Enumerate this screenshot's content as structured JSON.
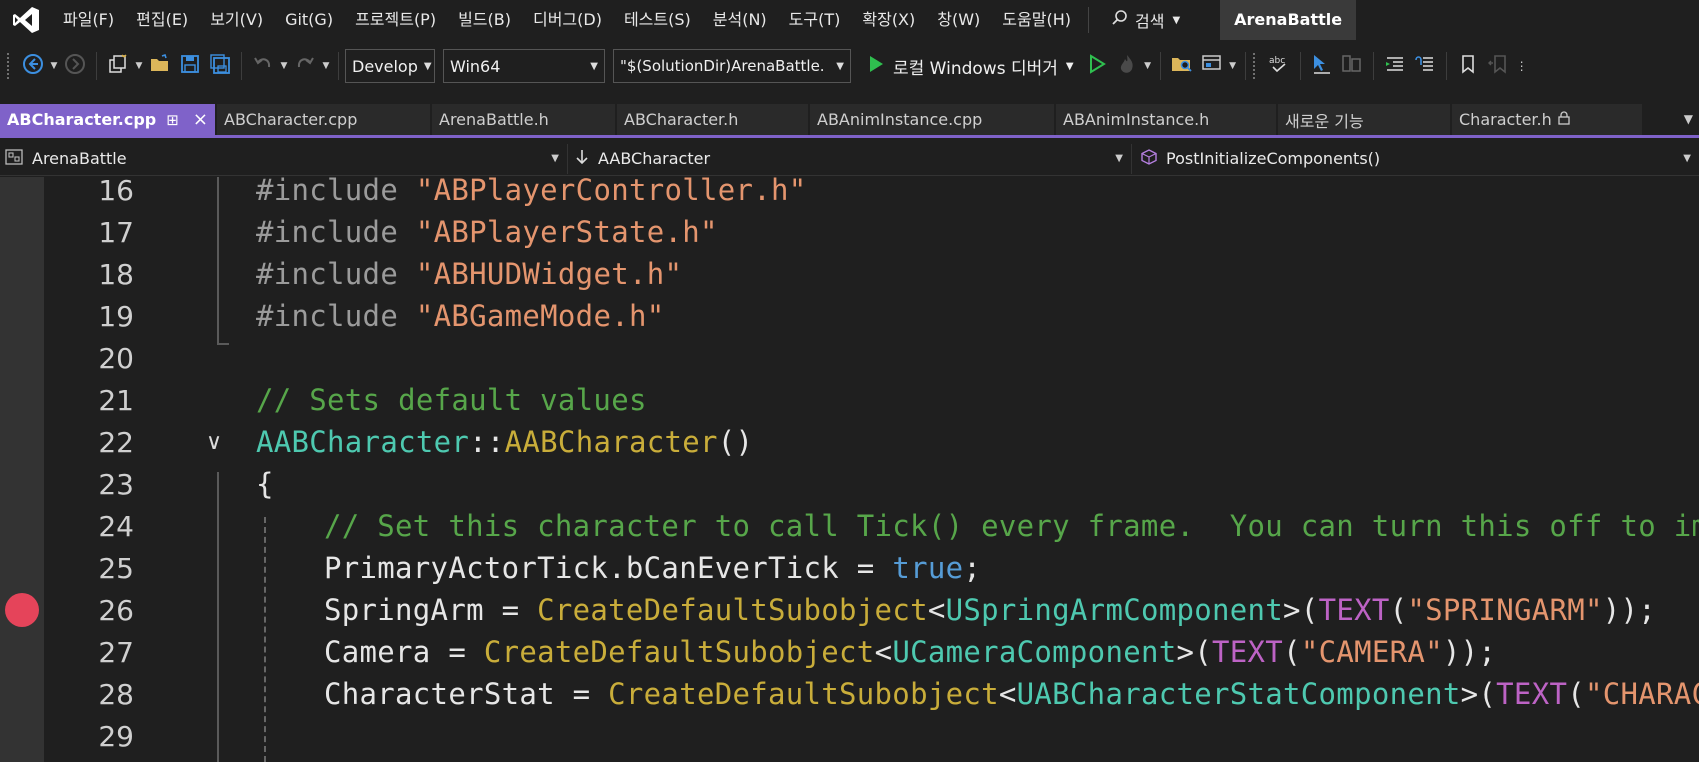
{
  "menu": {
    "items": [
      "파일(F)",
      "편집(E)",
      "보기(V)",
      "Git(G)",
      "프로젝트(P)",
      "빌드(B)",
      "디버그(D)",
      "테스트(S)",
      "분석(N)",
      "도구(T)",
      "확장(X)",
      "창(W)",
      "도움말(H)"
    ],
    "search_label": "검색",
    "solution_title": "ArenaBattle"
  },
  "toolbar": {
    "configuration": "Develop",
    "platform": "Win64",
    "startup_path": "\"$(SolutionDir)ArenaBattle.",
    "run_label": "로컬 Windows 디버거",
    "colors": {
      "run_green": "#2fbf4f",
      "accent_blue": "#3c8fe0"
    }
  },
  "tabs": [
    {
      "label": "ABCharacter.cpp",
      "active": true
    },
    {
      "label": "ABCharacter.cpp",
      "active": false
    },
    {
      "label": "ArenaBattle.h",
      "active": false
    },
    {
      "label": "ABCharacter.h",
      "active": false
    },
    {
      "label": "ABAnimInstance.cpp",
      "active": false
    },
    {
      "label": "ABAnimInstance.h",
      "active": false
    },
    {
      "label": "새로운 기능",
      "active": false
    },
    {
      "label": "Character.h",
      "active": false,
      "locked": true
    }
  ],
  "navbar": {
    "project": "ArenaBattle",
    "scope": "AABCharacter",
    "member": "PostInitializeComponents()"
  },
  "editor": {
    "breakpoint_line": 26,
    "lines": [
      {
        "n": "16",
        "tokens": [
          [
            "pp",
            "#include "
          ],
          [
            "str",
            "\"ABPlayerController.h\""
          ]
        ]
      },
      {
        "n": "17",
        "tokens": [
          [
            "pp",
            "#include "
          ],
          [
            "str",
            "\"ABPlayerState.h\""
          ]
        ]
      },
      {
        "n": "18",
        "tokens": [
          [
            "pp",
            "#include "
          ],
          [
            "str",
            "\"ABHUDWidget.h\""
          ]
        ]
      },
      {
        "n": "19",
        "tokens": [
          [
            "pp",
            "#include "
          ],
          [
            "str",
            "\"ABGameMode.h\""
          ]
        ]
      },
      {
        "n": "20",
        "tokens": []
      },
      {
        "n": "21",
        "tokens": [
          [
            "cm",
            "// Sets default values"
          ]
        ]
      },
      {
        "n": "22",
        "fold": true,
        "tokens": [
          [
            "ty",
            "AABCharacter"
          ],
          [
            "tx",
            "::"
          ],
          [
            "fn",
            "AABCharacter"
          ],
          [
            "tx",
            "()"
          ]
        ]
      },
      {
        "n": "23",
        "tokens": [
          [
            "tx",
            "{"
          ]
        ]
      },
      {
        "n": "24",
        "indent": 1,
        "tokens": [
          [
            "cm",
            "// Set this character to call Tick() every frame.  You can turn this off to impr"
          ]
        ]
      },
      {
        "n": "25",
        "indent": 1,
        "tokens": [
          [
            "tx",
            "PrimaryActorTick.bCanEverTick = "
          ],
          [
            "kw",
            "true"
          ],
          [
            "tx",
            ";"
          ]
        ]
      },
      {
        "n": "26",
        "indent": 1,
        "tokens": [
          [
            "tx",
            "SpringArm = "
          ],
          [
            "fn",
            "CreateDefaultSubobject"
          ],
          [
            "tx",
            "<"
          ],
          [
            "ty",
            "USpringArmComponent"
          ],
          [
            "tx",
            ">("
          ],
          [
            "mac",
            "TEXT"
          ],
          [
            "tx",
            "("
          ],
          [
            "str",
            "\"SPRINGARM\""
          ],
          [
            "tx",
            "));"
          ]
        ]
      },
      {
        "n": "27",
        "indent": 1,
        "tokens": [
          [
            "tx",
            "Camera = "
          ],
          [
            "fn",
            "CreateDefaultSubobject"
          ],
          [
            "tx",
            "<"
          ],
          [
            "ty",
            "UCameraComponent"
          ],
          [
            "tx",
            ">("
          ],
          [
            "mac",
            "TEXT"
          ],
          [
            "tx",
            "("
          ],
          [
            "str",
            "\"CAMERA\""
          ],
          [
            "tx",
            "));"
          ]
        ]
      },
      {
        "n": "28",
        "indent": 1,
        "tokens": [
          [
            "tx",
            "CharacterStat = "
          ],
          [
            "fn",
            "CreateDefaultSubobject"
          ],
          [
            "tx",
            "<"
          ],
          [
            "ty",
            "UABCharacterStatComponent"
          ],
          [
            "tx",
            ">("
          ],
          [
            "mac",
            "TEXT"
          ],
          [
            "tx",
            "("
          ],
          [
            "str",
            "\"CHARACTE"
          ]
        ]
      },
      {
        "n": "29",
        "indent": 1,
        "tokens": []
      }
    ]
  }
}
